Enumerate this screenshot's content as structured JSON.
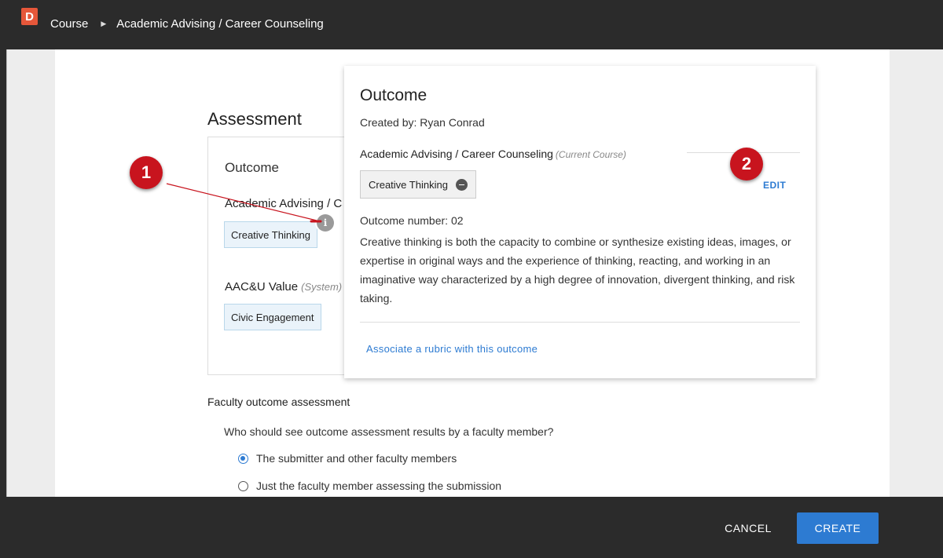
{
  "header": {
    "logo_letter": "D",
    "breadcrumb": [
      "Course",
      "Academic Advising / Career Counseling"
    ]
  },
  "assessment": {
    "title": "Assessment",
    "outcome_label": "Outcome",
    "course_label": "Academic Advising / Career Counseling",
    "outcome_chip": "Creative Thinking",
    "aacu_label": "AAC&U Value",
    "aacu_suffix": "(System)",
    "aacu_chip": "Civic Engagement"
  },
  "popover": {
    "title": "Outcome",
    "created_by": "Created by: Ryan Conrad",
    "course": "Academic Advising / Career Counseling",
    "course_suffix": "(Current Course)",
    "chip": "Creative Thinking",
    "edit_label": "EDIT",
    "outcome_number": "Outcome number: 02",
    "description": "Creative thinking is both the capacity to combine or synthesize existing ideas, images, or expertise in original ways and the experience of thinking, reacting, and working in an imaginative way characterized by a high degree of innovation, divergent thinking, and risk taking.",
    "rubric_link": "Associate a rubric with this outcome"
  },
  "callouts": [
    "1",
    "2"
  ],
  "faculty": {
    "title": "Faculty outcome assessment",
    "question": "Who should see outcome assessment results by a faculty member?",
    "options": [
      {
        "label": "The submitter and other faculty members",
        "checked": true
      },
      {
        "label": "Just the faculty member assessing the submission",
        "checked": false
      }
    ]
  },
  "footer": {
    "cancel_label": "CANCEL",
    "create_label": "CREATE"
  },
  "colors": {
    "accent": "#2d7bd2",
    "callout": "#c8141e",
    "logo": "#e6573a"
  }
}
